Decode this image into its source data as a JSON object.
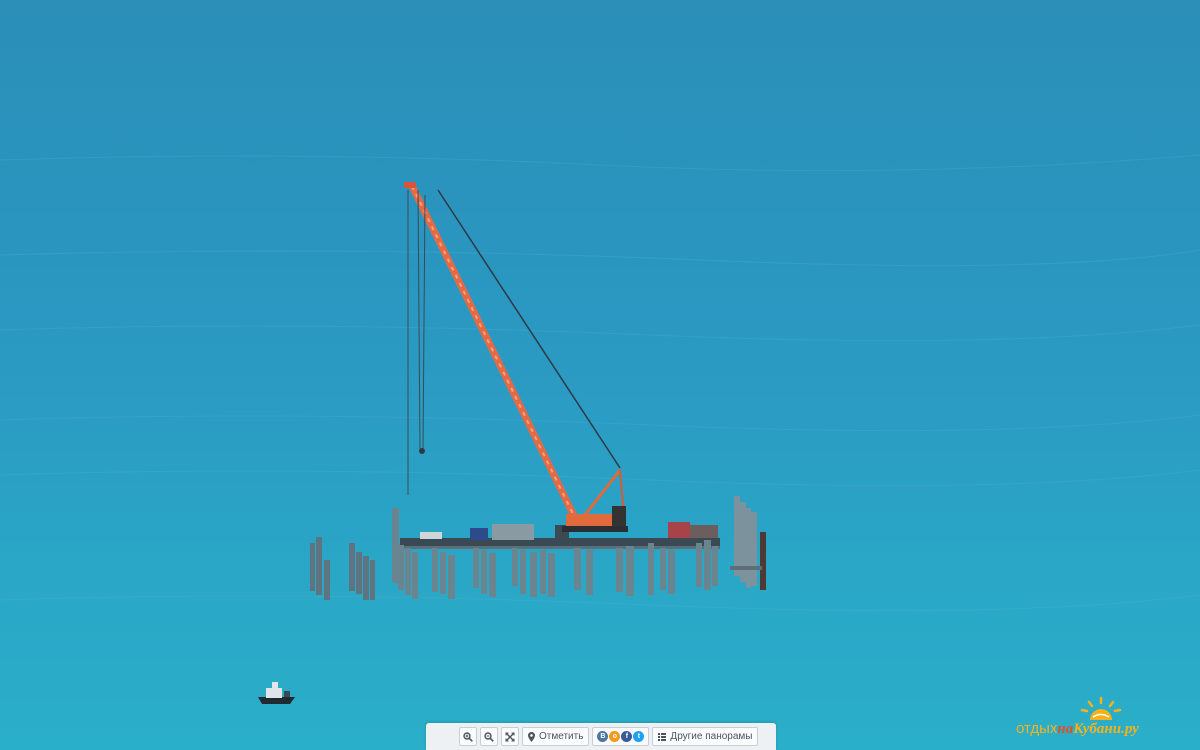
{
  "toolbar": {
    "zoom_in_label": "zoom-in",
    "zoom_out_label": "zoom-out",
    "fullscreen_label": "fullscreen",
    "mark_label": "Отметить",
    "social": [
      {
        "name": "vk",
        "letter": "В",
        "color": "#4c75a3"
      },
      {
        "name": "odnoklassniki",
        "letter": "о",
        "color": "#f29a1b"
      },
      {
        "name": "facebook",
        "letter": "f",
        "color": "#3b5998"
      },
      {
        "name": "twitter",
        "letter": "t",
        "color": "#1da1f2"
      }
    ],
    "other_panoramas_label": "Другие панорамы"
  },
  "logo": {
    "part1": "отдых",
    "part2": "на",
    "part3": "Кубани.ру"
  },
  "colors": {
    "sea_top": "#2b8fb8",
    "sea_bottom": "#2aafc9",
    "crane": "#e06a3c",
    "logo_orange": "#f7b21b",
    "logo_red": "#e94e1b"
  }
}
